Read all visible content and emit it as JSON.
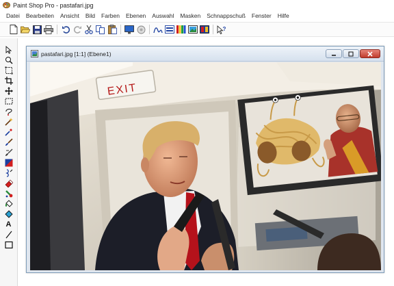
{
  "app": {
    "title": "Paint Shop Pro - pastafari.jpg",
    "icon": "paint-palette-icon"
  },
  "menu": [
    "Datei",
    "Bearbeiten",
    "Ansicht",
    "Bild",
    "Farben",
    "Ebenen",
    "Auswahl",
    "Masken",
    "Schnappschuß",
    "Fenster",
    "Hilfe"
  ],
  "toolbar": {
    "buttons": [
      "new-icon",
      "open-icon",
      "save-icon",
      "print-icon",
      "undo-icon",
      "redo-icon",
      "cut-icon",
      "copy-icon",
      "paste-icon",
      "full-screen-preview-icon",
      "browse-icon",
      "histogram-icon",
      "layer-palette-icon",
      "color-palette-icon",
      "overview-icon",
      "tool-palette-icon",
      "context-help-icon"
    ]
  },
  "tools": [
    "arrow-tool-icon",
    "zoom-tool-icon",
    "deformation-tool-icon",
    "crop-tool-icon",
    "mover-tool-icon",
    "selection-tool-icon",
    "freehand-selection-icon",
    "magic-wand-icon",
    "dropper-icon",
    "paintbrush-icon",
    "clone-brush-icon",
    "color-replacer-icon",
    "retouch-icon",
    "eraser-icon",
    "picture-tube-icon",
    "flood-fill-icon",
    "text-tool-icon",
    "line-tool-icon",
    "shape-tool-icon"
  ],
  "document": {
    "title": "pastafari.jpg [1:1] (Ebene1)",
    "image": {
      "sign_text": "EXIT",
      "colors": {
        "wall": "#d9d3c4",
        "ceiling": "#ece6da",
        "suit": "#1c1e28",
        "tie": "#b5121b",
        "skin": "#e2a887",
        "hair": "#d8b06a",
        "robe": "#a8322a",
        "saffron": "#d99b27",
        "tv_frame": "#2a2a2a"
      }
    }
  }
}
